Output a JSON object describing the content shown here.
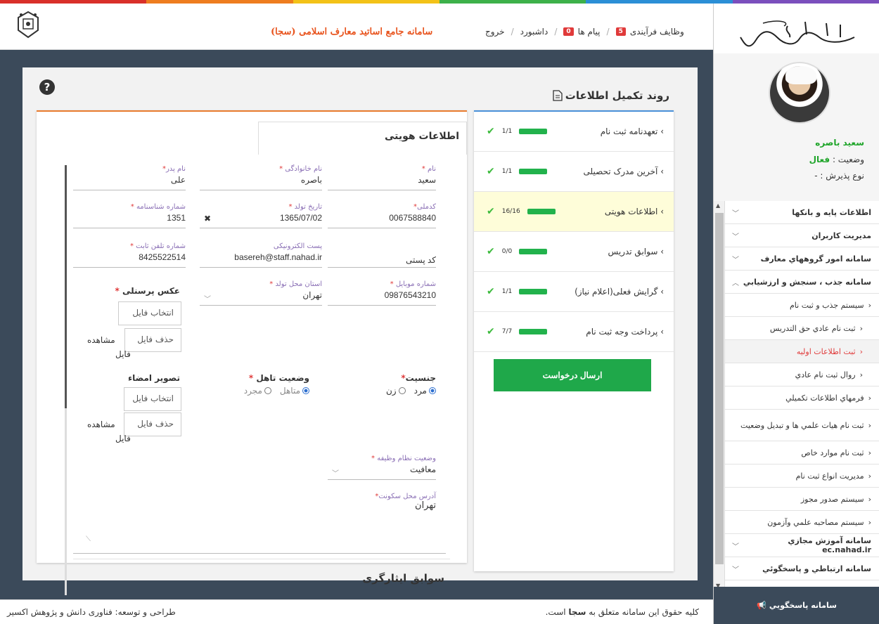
{
  "colors": [
    "#d9302a",
    "#ee7d1f",
    "#f3c218",
    "#3db14a",
    "#2b8fd6",
    "#7b4fbd"
  ],
  "header": {
    "app_title": "سامانه جامع اساتید معارف اسلامی (سجا)",
    "nav": {
      "tasks": "وظایف فرآیندی",
      "tasks_count": "5",
      "messages": "پیام ها",
      "messages_count": "0",
      "dashboard": "داشبورد",
      "logout": "خروج"
    }
  },
  "profile": {
    "name": "سعید باصره",
    "status_label": "وضعیت :",
    "status_value": "فعال",
    "admission_type": "نوع پذیرش : -"
  },
  "sidebar_menu": {
    "item1": "اطلاعات پایه و بانکها",
    "item2": "مدیریت کاربران",
    "item3": "سامانه امور گروههاي معارف",
    "item4": "سامانه جذب ، سنجش و ارزشيابي",
    "sub1": "سيستم جذب و ثبت نام",
    "sub2": "ثبت نام عادي حق التدريس",
    "sub3": "ثبت اطلاعات اوليه",
    "sub4": "روال ثبت نام عادي",
    "sub5": "فرمهاي اطلاعات تكميلي",
    "sub6": "ثبت نام هيات علمي ها و تبديل وضعيت",
    "sub7": "ثبت نام موارد خاص",
    "sub8": "مديريت انواع ثبت نام",
    "sub9": "سيستم صدور مجوز",
    "sub10": "سيستم مصاحبه علمي وآزمون",
    "item5": "سامانه آموزش مجازي ec.nahad.ir",
    "item6": "سامانه ارتباطي و پاسخگوئي",
    "bottom_box": "سامانه پاسخگويي"
  },
  "process": {
    "title": "روند تکمیل اطلاعات",
    "steps": [
      {
        "label": "تعهدنامه ثبت نام",
        "ratio": "1/1",
        "progress": 1
      },
      {
        "label": "آخرین مدرک تحصیلی",
        "ratio": "1/1",
        "progress": 1
      },
      {
        "label": "اطلاعات هویتی",
        "ratio": "16/16",
        "progress": 1
      },
      {
        "label": "سوابق تدریس",
        "ratio": "0/0",
        "progress": 1
      },
      {
        "label": "گرایش فعلی(اعلام نیاز)",
        "ratio": "1/1",
        "progress": 1
      },
      {
        "label": "پرداخت وجه ثبت نام",
        "ratio": "7/7",
        "progress": 1
      }
    ],
    "submit": "ارسال درخواست"
  },
  "form": {
    "tab_title": "اطلاعات هویتی",
    "help": "?",
    "first_name": {
      "label": "نام",
      "value": "سعید"
    },
    "last_name": {
      "label": "نام خانوادگی",
      "value": "باصره"
    },
    "father_name": {
      "label": "نام پدر",
      "value": "علی"
    },
    "national_code": {
      "label": "کدملی",
      "value": "0067588840"
    },
    "birth_date": {
      "label": "تاریخ تولد",
      "value": "1365/07/02"
    },
    "id_number": {
      "label": "شماره شناسنامه",
      "value": "1351"
    },
    "postal_code": {
      "label": "کد پستی"
    },
    "email": {
      "label": "پست الکترونیکی",
      "value": "basereh@staff.nahad.ir"
    },
    "phone": {
      "label": "شماره تلفن ثابت",
      "value": "8425522514"
    },
    "mobile": {
      "label": "شماره موبایل",
      "value": "09876543210"
    },
    "birth_province": {
      "label": "استان محل تولد",
      "value": "تهران"
    },
    "photo": {
      "label": "عکس پرسنلی",
      "choose": "انتخاب فایل",
      "delete": "حذف فایل",
      "view": "مشاهده",
      "view2": "فایل"
    },
    "signature": {
      "label": "تصویر امضاء",
      "choose": "انتخاب فایل",
      "delete": "حذف فایل",
      "view": "مشاهده",
      "view2": "فایل"
    },
    "gender": {
      "label": "جنسیت",
      "male": "مرد",
      "female": "زن"
    },
    "marital": {
      "label": "وضعیت تاهل",
      "married": "متاهل",
      "single": "مجرد"
    },
    "military": {
      "label": "وضعیت نظام وظیفه",
      "value": "معافیت"
    },
    "address": {
      "label": "آدرس محل سکونت",
      "value": "تهران"
    },
    "veteran_section": "سوابق ایثارگری"
  },
  "footer": {
    "copyright_prefix": "کلیه حقوق این سامانه متعلق به",
    "copyright_brand": "سجا",
    "copyright_suffix": "است.",
    "credit": "طراحی و توسعه: فناوری دانش و پژوهش اکسیر"
  }
}
